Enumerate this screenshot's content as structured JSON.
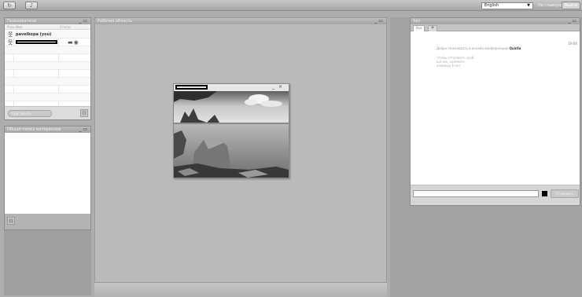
{
  "topbar": {
    "left_icons": [
      "refresh-icon",
      "microphone-icon"
    ],
    "language": "English",
    "link": "На главную",
    "button": "Выйти"
  },
  "users_panel": {
    "title": "Пользователи",
    "columns": {
      "role": "Роль",
      "name": "Имя",
      "status": "Статус"
    },
    "rows": [
      {
        "name": "pavelkopa (you)",
        "icon": "user-icon"
      },
      {
        "name": "",
        "icon": "user-icon",
        "status_icons": [
          "monitor-icon",
          "webcam-icon"
        ]
      }
    ],
    "footer_button": "Пригласить"
  },
  "second_panel": {
    "title": "Общая папка материалов"
  },
  "center_panel": {
    "title": "Рабочая область"
  },
  "viewer": {
    "controls": [
      "minimize-icon",
      "close-icon"
    ]
  },
  "chat": {
    "title": "Чат",
    "tab_label": "Все",
    "add_label": "+",
    "time": "19:00",
    "welcome_prefix": "Добро пожаловать в онлайн-конференцию",
    "welcome_brand": "Quatla",
    "sub_lines": [
      "Чтобы отправить сооб-",
      "щение, нажмите",
      "клавишу Enter"
    ],
    "send_label": "Отправить",
    "color": "#000000"
  }
}
